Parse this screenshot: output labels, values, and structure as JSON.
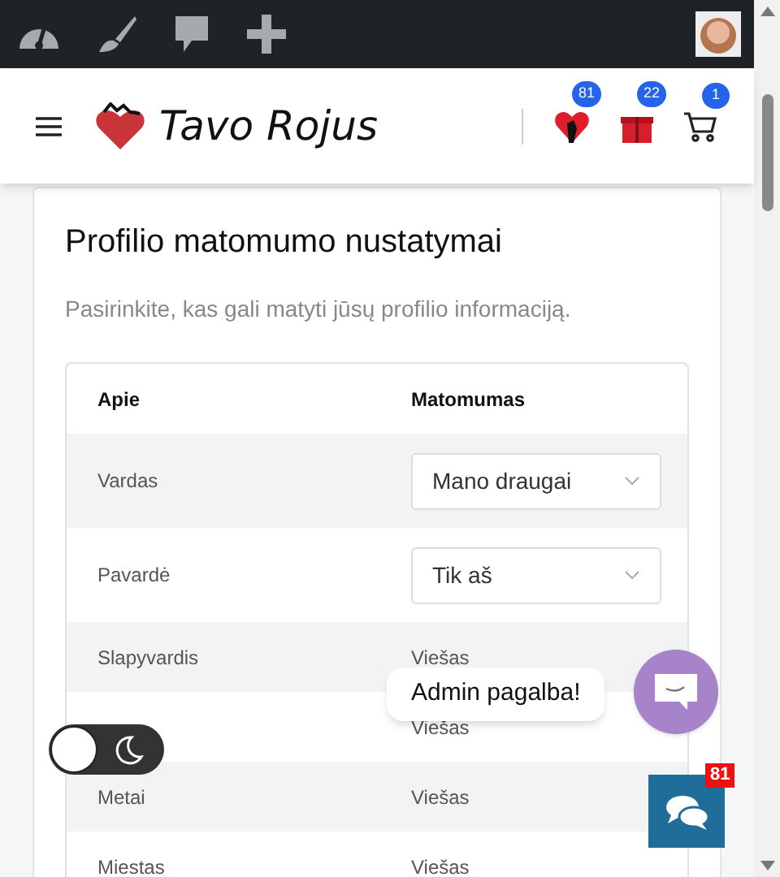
{
  "admin_bar": {
    "items": [
      {
        "kind": "dashboard"
      },
      {
        "kind": "brush"
      },
      {
        "kind": "comment"
      },
      {
        "kind": "plus"
      }
    ]
  },
  "header": {
    "logo_text": "Tavo Rojus",
    "badges": [
      {
        "kind": "heart",
        "count": "81"
      },
      {
        "kind": "gift",
        "count": "22"
      },
      {
        "kind": "cart",
        "count": "1"
      }
    ]
  },
  "card": {
    "title": "Profilio matomumo nustatymai",
    "subtitle": "Pasirinkite, kas gali matyti jūsų profilio informaciją.",
    "table": {
      "columns": [
        "Apie",
        "Matomumas"
      ],
      "rows": [
        {
          "label": "Vardas",
          "kind": "select",
          "value": "Mano draugai"
        },
        {
          "label": "Pavardė",
          "kind": "select",
          "value": "Tik aš"
        },
        {
          "label": "Slapyvardis",
          "kind": "text",
          "value": "Viešas"
        },
        {
          "kind": "text",
          "value": "Viešas"
        },
        {
          "label": "Metai",
          "kind": "text",
          "value": "Viešas"
        },
        {
          "label": "Miestas",
          "kind": "text",
          "value": "Viešas"
        }
      ]
    }
  },
  "dark_mode_toggle": {
    "on": false
  },
  "help_bubble": {
    "text": "Admin pagalba!"
  },
  "chat_button": {
    "count": "81"
  }
}
